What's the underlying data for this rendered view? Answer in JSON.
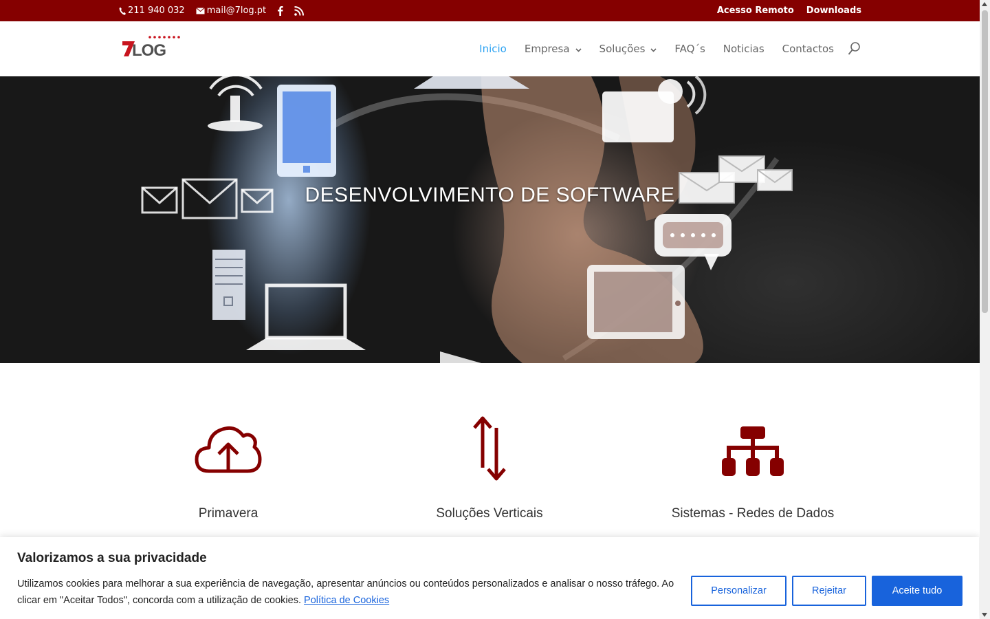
{
  "topbar": {
    "phone": "211 940 032",
    "email": "mail@7log.pt",
    "links": [
      "Acesso Remoto",
      "Downloads"
    ],
    "phone_icon": "phone-icon",
    "email_icon": "envelope-icon",
    "social_icons": [
      "facebook-icon",
      "rss-icon"
    ]
  },
  "header": {
    "logo_text": "7LOG",
    "nav": [
      {
        "label": "Inicio",
        "active": true,
        "dropdown": false
      },
      {
        "label": "Empresa",
        "active": false,
        "dropdown": true
      },
      {
        "label": "Soluções",
        "active": false,
        "dropdown": true
      },
      {
        "label": "FAQ´s",
        "active": false,
        "dropdown": false
      },
      {
        "label": "Noticias",
        "active": false,
        "dropdown": false
      },
      {
        "label": "Contactos",
        "active": false,
        "dropdown": false
      }
    ],
    "search_icon": "search-icon"
  },
  "hero": {
    "title": "DESENVOLVIMENTO DE SOFTWARE"
  },
  "features": [
    {
      "label": "Primavera",
      "icon": "cloud-upload-icon"
    },
    {
      "label": "Soluções Verticais",
      "icon": "up-down-arrows-icon"
    },
    {
      "label": "Sistemas - Redes de Dados",
      "icon": "network-sitemap-icon"
    }
  ],
  "cookie": {
    "title": "Valorizamos a sua privacidade",
    "text": "Utilizamos cookies para melhorar a sua experiência de navegação, apresentar anúncios ou conteúdos personalizados e analisar o nosso tráfego. Ao clicar em \"Aceitar Todos\", concorda com a utilização de cookies.",
    "policy_link": "Política de Cookies",
    "buttons": {
      "customize": "Personalizar",
      "reject": "Rejeitar",
      "accept": "Aceite tudo"
    }
  },
  "colors": {
    "brand": "#850000",
    "nav_active": "#2ea3f2",
    "cookie_accent": "#1863dc"
  }
}
